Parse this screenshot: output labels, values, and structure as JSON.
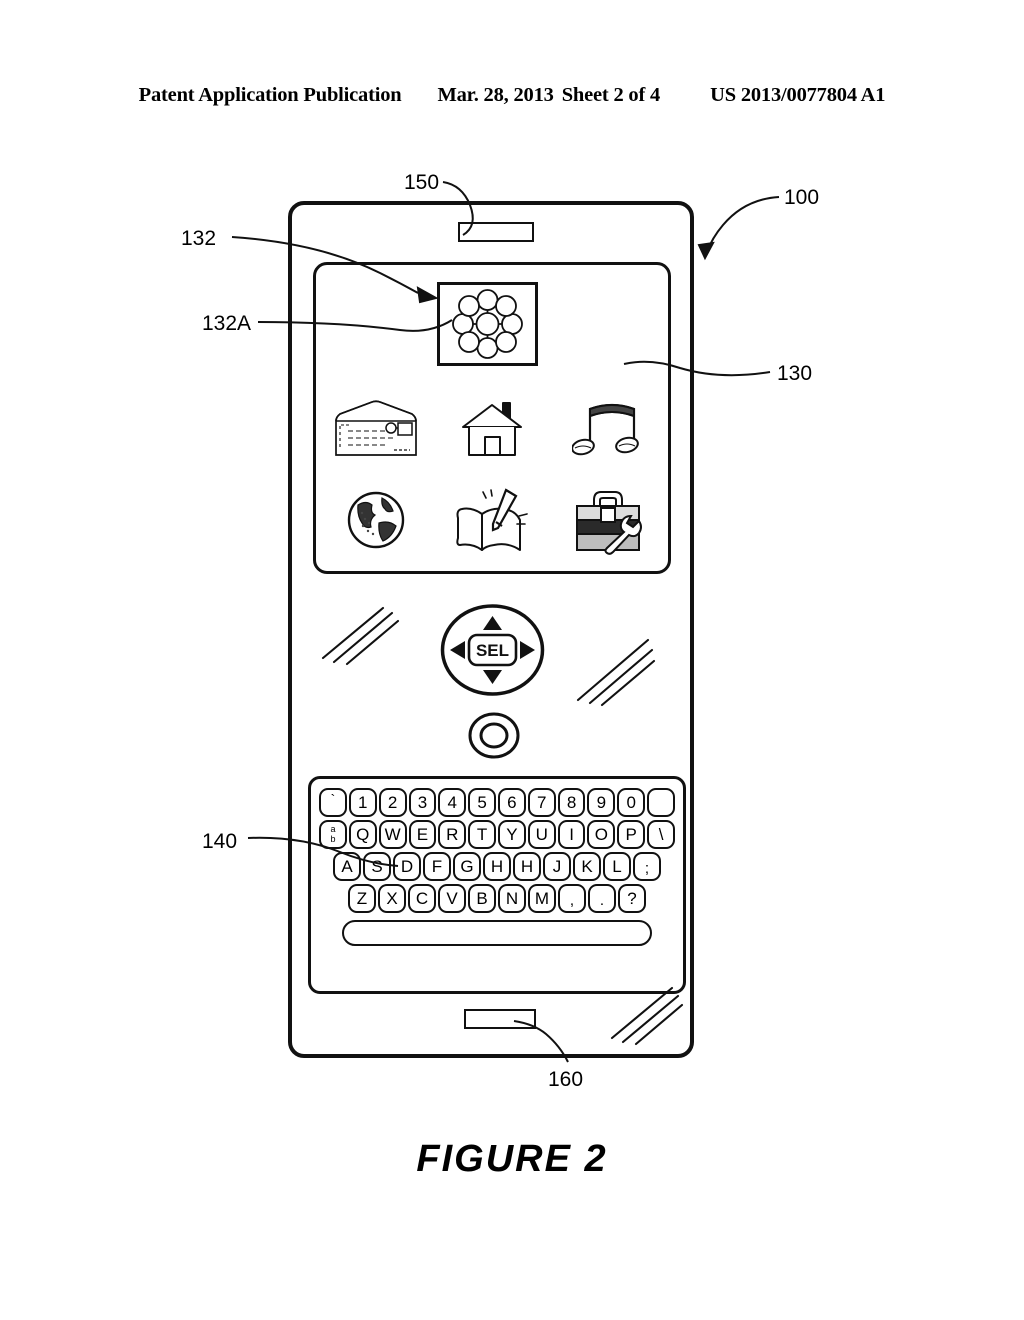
{
  "header": {
    "publication": "Patent Application Publication",
    "date": "Mar. 28, 2013",
    "sheet": "Sheet 2 of 4",
    "docnum": "US 2013/0077804 A1"
  },
  "figure": {
    "caption": "FIGURE  2"
  },
  "reference_numerals": {
    "device": "100",
    "display": "130",
    "icon_group": "132",
    "selected_icon": "132A",
    "keyboard": "140",
    "speaker": "150",
    "microphone": "160"
  },
  "display": {
    "selected_icon": {
      "name": "cluster-of-circles-icon",
      "center_circles": 1,
      "surrounding_circles": 8
    },
    "icons": [
      {
        "name": "envelope-icon",
        "label": "Mail"
      },
      {
        "name": "house-icon",
        "label": "Home"
      },
      {
        "name": "music-note-icon",
        "label": "Music"
      },
      {
        "name": "globe-icon",
        "label": "Browser"
      },
      {
        "name": "book-pen-icon",
        "label": "Notes"
      },
      {
        "name": "toolbox-icon",
        "label": "Tools"
      }
    ]
  },
  "navigation": {
    "select_label": "SEL",
    "directions": [
      "up",
      "left",
      "right",
      "down"
    ],
    "action_button": "circle-button"
  },
  "keyboard": {
    "rows": [
      [
        {
          "label": "`",
          "type": "tick"
        },
        {
          "label": "1"
        },
        {
          "label": "2"
        },
        {
          "label": "3"
        },
        {
          "label": "4"
        },
        {
          "label": "5"
        },
        {
          "label": "6"
        },
        {
          "label": "7"
        },
        {
          "label": "8"
        },
        {
          "label": "9"
        },
        {
          "label": "0"
        },
        {
          "label": "",
          "type": "blank"
        }
      ],
      [
        {
          "label": "a",
          "sub": "b",
          "type": "alt"
        },
        {
          "label": "Q"
        },
        {
          "label": "W"
        },
        {
          "label": "E"
        },
        {
          "label": "R"
        },
        {
          "label": "T"
        },
        {
          "label": "Y"
        },
        {
          "label": "U"
        },
        {
          "label": "I"
        },
        {
          "label": "O"
        },
        {
          "label": "P"
        },
        {
          "label": "\\"
        }
      ],
      [
        {
          "label": "A"
        },
        {
          "label": "S"
        },
        {
          "label": "D"
        },
        {
          "label": "F"
        },
        {
          "label": "G"
        },
        {
          "label": "H"
        },
        {
          "label": "H"
        },
        {
          "label": "J"
        },
        {
          "label": "K"
        },
        {
          "label": "L"
        },
        {
          "label": ";",
          "type": "low"
        }
      ],
      [
        {
          "label": "Z"
        },
        {
          "label": "X"
        },
        {
          "label": "C"
        },
        {
          "label": "V"
        },
        {
          "label": "B"
        },
        {
          "label": "N"
        },
        {
          "label": "M"
        },
        {
          "label": ",",
          "type": "low"
        },
        {
          "label": ".",
          "type": "low"
        },
        {
          "label": "?"
        }
      ]
    ],
    "spacebar": ""
  },
  "colors": {
    "ink": "#111111",
    "paper": "#ffffff"
  }
}
